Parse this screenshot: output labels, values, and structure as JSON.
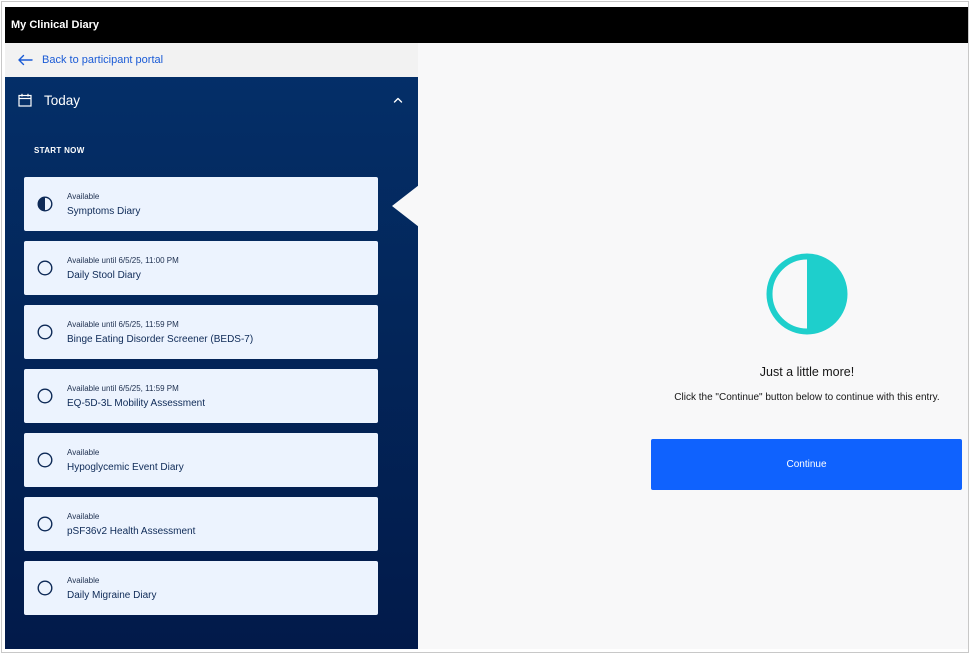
{
  "app": {
    "title": "My Clinical Diary"
  },
  "sidebar": {
    "back_link": "Back to participant portal",
    "group_label": "Today",
    "section_label": "START NOW",
    "tasks": [
      {
        "availability": "Available",
        "name": "Symptoms Diary",
        "status": "in-progress"
      },
      {
        "availability": "Available until 6/5/25, 11:00 PM",
        "name": "Daily Stool Diary",
        "status": "not-started"
      },
      {
        "availability": "Available until 6/5/25, 11:59 PM",
        "name": "Binge Eating Disorder Screener (BEDS-7)",
        "status": "not-started"
      },
      {
        "availability": "Available until 6/5/25, 11:59 PM",
        "name": "EQ-5D-3L Mobility Assessment",
        "status": "not-started"
      },
      {
        "availability": "Available",
        "name": "Hypoglycemic Event Diary",
        "status": "not-started"
      },
      {
        "availability": "Available",
        "name": "pSF36v2 Health Assessment",
        "status": "not-started"
      },
      {
        "availability": "Available",
        "name": "Daily Migraine Diary",
        "status": "not-started"
      }
    ]
  },
  "main": {
    "icon": "half-filled-circle-icon",
    "headline": "Just a little more!",
    "message": "Click the \"Continue\" button below to continue with this entry.",
    "continue_label": "Continue"
  },
  "colors": {
    "accent": "#0f62fe",
    "progress_teal": "#1ecfcc",
    "sidebar_bg": "#04306a",
    "link": "#1a5bd6"
  }
}
